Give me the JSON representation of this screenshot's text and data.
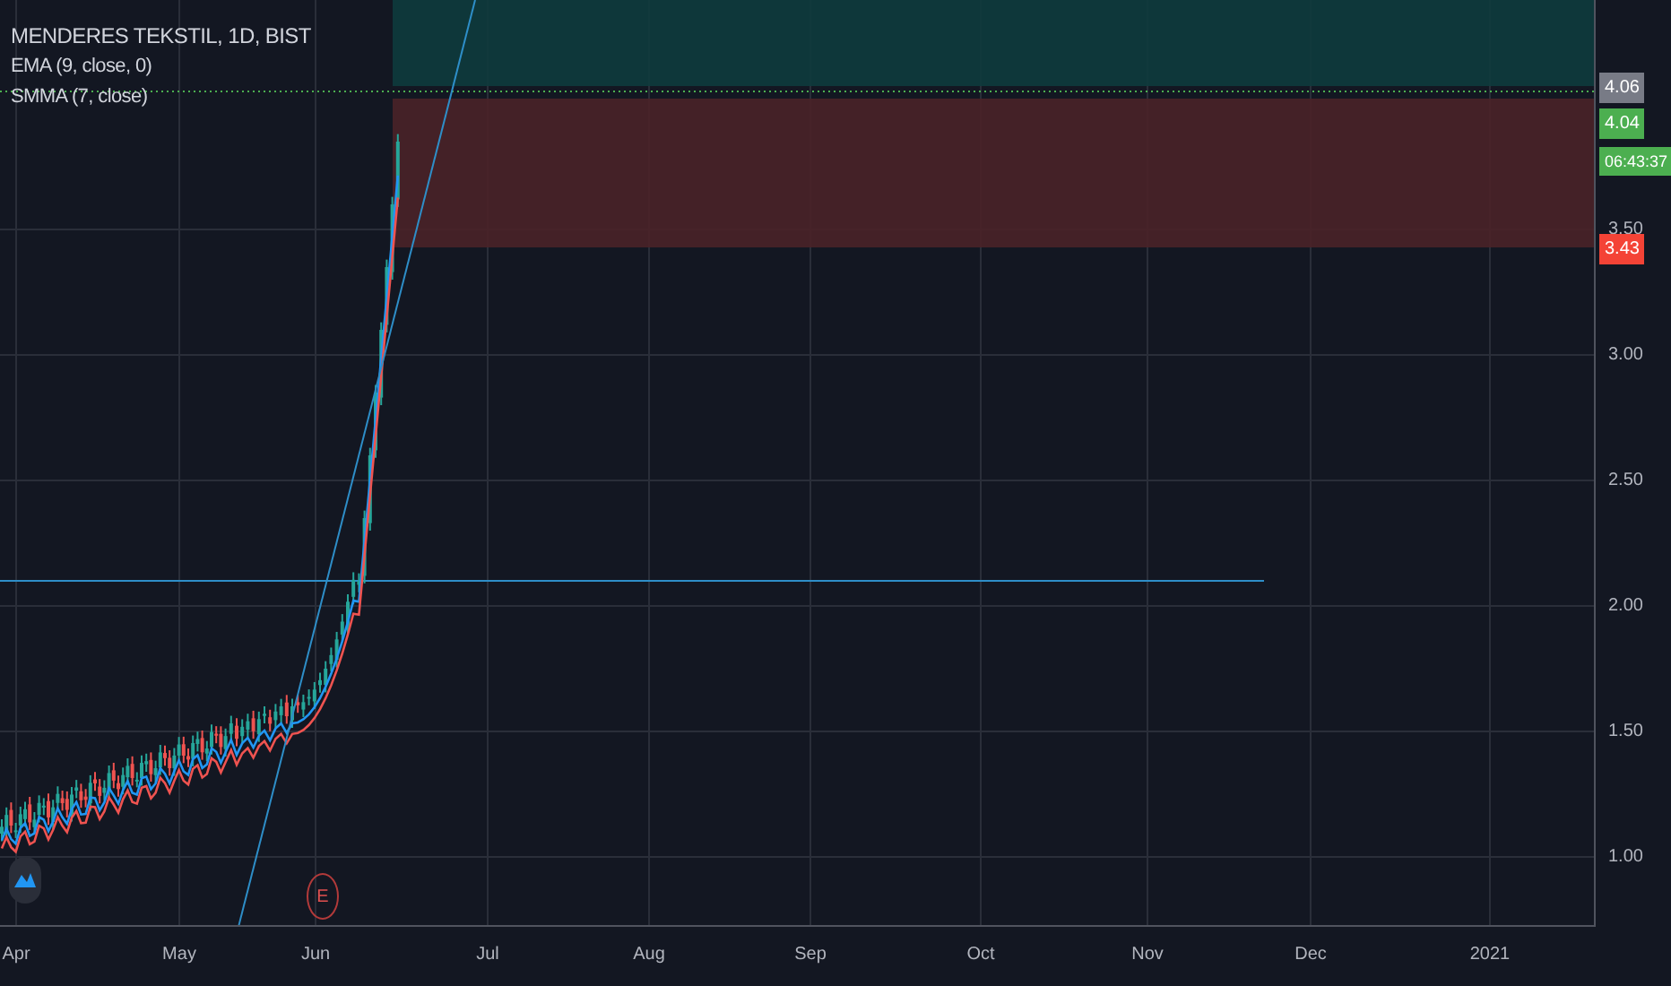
{
  "legend": [
    {
      "text": "MENDERES TEKSTIL, 1D, BIST",
      "kind": "title"
    },
    {
      "text": "EMA (9, close, 0)",
      "kind": "study"
    },
    {
      "text": "SMMA (7, close)",
      "kind": "study"
    }
  ],
  "price_axis": {
    "ticks": [
      "3.50",
      "3.00",
      "2.50",
      "2.00",
      "1.50",
      "1.00"
    ],
    "labels": [
      {
        "text": "4.06",
        "color": "#787b86",
        "kind": "price"
      },
      {
        "text": "4.04",
        "color": "#4caf50",
        "kind": "price"
      },
      {
        "text": "06:43:37",
        "color": "#4caf50",
        "kind": "countdown"
      },
      {
        "text": "3.43",
        "color": "#f44336",
        "kind": "price"
      }
    ]
  },
  "time_axis": [
    "Apr",
    "May",
    "Jun",
    "Jul",
    "Aug",
    "Sep",
    "Oct",
    "Nov",
    "Dec",
    "2021"
  ],
  "earnings_marker": "E"
}
